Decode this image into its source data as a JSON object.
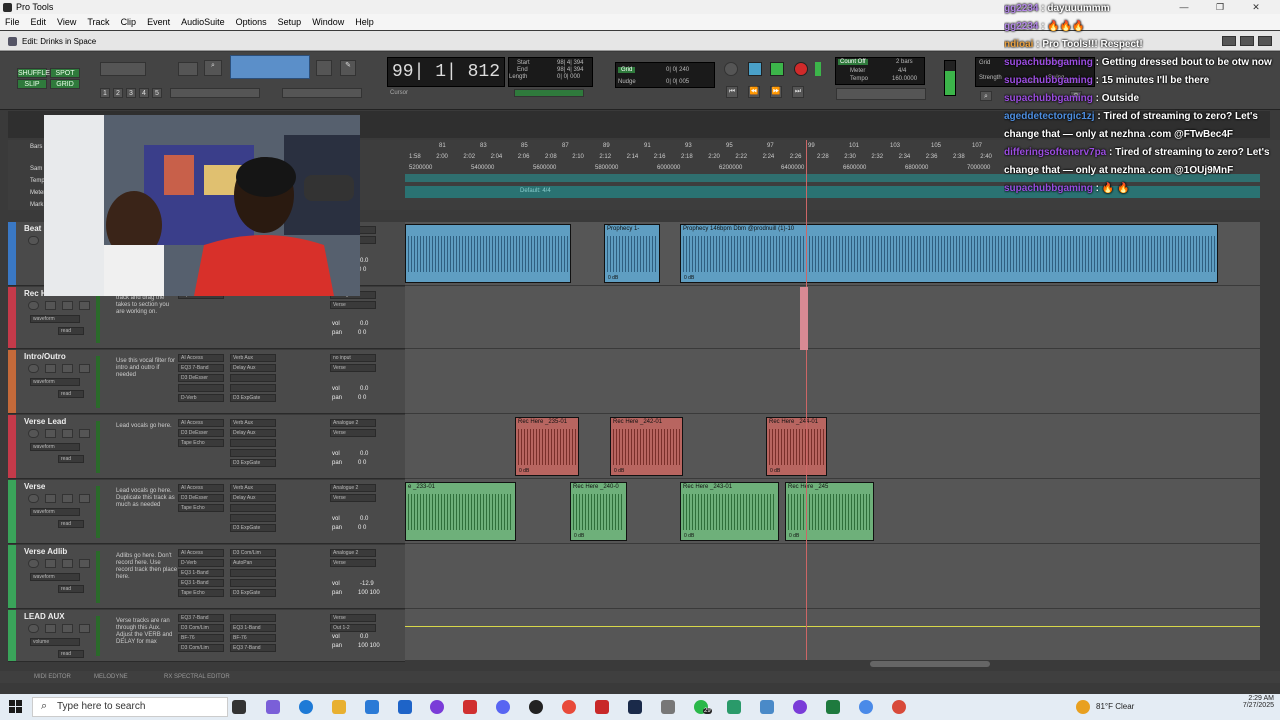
{
  "window": {
    "title": "Pro Tools",
    "controls": [
      "—",
      "❐",
      "✕"
    ]
  },
  "menu": [
    "File",
    "Edit",
    "View",
    "Track",
    "Clip",
    "Event",
    "AudioSuite",
    "Options",
    "Setup",
    "Window",
    "Help"
  ],
  "edit_window": {
    "title": "Edit: Drinks in Space"
  },
  "toolbar": {
    "modes": [
      "SHUFFLE",
      "SPOT",
      "SLIP",
      "GRID"
    ],
    "zoom_presets": [
      "1",
      "2",
      "3",
      "4",
      "5"
    ],
    "main_counter": "99| 1| 812",
    "counter_label": "Cursor",
    "start_label": "Start",
    "start_value": "98| 4| 394",
    "end_label": "End",
    "end_value": "98| 4| 394",
    "length_label": "Length",
    "length_value": "0| 0| 000",
    "grid_label": "Grid",
    "grid_value": "0| 0| 240",
    "nudge_label": "Nudge",
    "nudge_value": "0| 0| 005",
    "count_off": "Count Off",
    "count_bars": "2 bars",
    "meter_label": "Meter",
    "meter_value": "4/4",
    "tempo_label": "Tempo",
    "tempo_value": "160.0000",
    "grid2_label": "Grid",
    "grid2_value": "1/16 note",
    "strength_label": "Strength",
    "strength_value": "100%",
    "swing_label": "Swing",
    "swing_value": "100%"
  },
  "ruler": {
    "bars_label": "Bars",
    "bars": [
      "81",
      "83",
      "85",
      "87",
      "89",
      "91",
      "93",
      "95",
      "97",
      "99",
      "101",
      "103",
      "105",
      "107"
    ],
    "times": [
      "1:58",
      "2:00",
      "2:02",
      "2:04",
      "2:06",
      "2:08",
      "2:10",
      "2:12",
      "2:14",
      "2:16",
      "2:18",
      "2:20",
      "2:22",
      "2:24",
      "2:26",
      "2:28",
      "2:30",
      "2:32",
      "2:34",
      "2:36",
      "2:38",
      "2:40"
    ],
    "samples": [
      "5200000",
      "5400000",
      "5600000",
      "5800000",
      "6000000",
      "6200000",
      "6400000",
      "6600000",
      "6800000",
      "7000000"
    ],
    "meter_marker": "Default: 4/4",
    "side_labels": [
      "Sam",
      "Temp",
      "Meter",
      "Mark"
    ]
  },
  "tracks": [
    {
      "name": "Beat",
      "comment": "",
      "color": "#3a78c4",
      "inserts": [],
      "sends": [],
      "io": [
        "",
        ""
      ],
      "vol": "0.0",
      "pan": "0 0",
      "clips": [
        {
          "name": "",
          "start": 0,
          "end": 166,
          "color": "blue",
          "db": ""
        },
        {
          "name": "Prophecy 1-",
          "start": 199,
          "end": 255,
          "color": "blue",
          "db": "0 dB"
        },
        {
          "name": "Prophecy 146bpm Dbm @prodnuill (1)-10",
          "start": 275,
          "end": 813,
          "color": "blue",
          "db": "0 dB"
        }
      ]
    },
    {
      "name": "Rec Here",
      "comment": "track and drag the takes to section you are working on.",
      "color": "#c43a4a",
      "inserts": [
        "Tape Echo"
      ],
      "sends": [],
      "io": [
        "Analogue 2",
        "Verse"
      ],
      "vol": "0.0",
      "pan": "0 0",
      "mode": "waveform",
      "auto": "read",
      "clips": []
    },
    {
      "name": "Intro/Outro",
      "comment": "Use this vocal filter for intro and outro if needed",
      "color": "#c46a3a",
      "inserts": [
        "AI Access",
        "EQ3 7-Band",
        "D3 DeEsser",
        "",
        "D-Verb"
      ],
      "sends": [
        "Verb Aux",
        "Delay Aux",
        "",
        "",
        "D3 ExpGate"
      ],
      "io": [
        "no input",
        "Verse"
      ],
      "vol": "0.0",
      "pan": "0 0",
      "mode": "waveform",
      "auto": "read",
      "clips": []
    },
    {
      "name": "Verse Lead",
      "comment": "Lead vocals go here.",
      "color": "#c43a4a",
      "inserts": [
        "AI Access",
        "D3 DeEsser",
        "Tape Echo"
      ],
      "sends": [
        "Verb Aux",
        "Delay Aux",
        "",
        "",
        "D3 ExpGate"
      ],
      "io": [
        "Analogue 2",
        "Verse"
      ],
      "vol": "0.0",
      "pan": "0 0",
      "mode": "waveform",
      "auto": "read",
      "clips": [
        {
          "name": "Rec Here _235-01",
          "start": 110,
          "end": 174,
          "color": "red",
          "db": "0 dB"
        },
        {
          "name": "Rec Here _242-01",
          "start": 205,
          "end": 278,
          "color": "red",
          "db": "0 dB"
        },
        {
          "name": "Rec Here _244-01",
          "start": 361,
          "end": 422,
          "color": "red",
          "db": "0 dB"
        }
      ]
    },
    {
      "name": "Verse",
      "comment": "Lead vocals go here. Duplicate this track as much as needed",
      "color": "#3aa45a",
      "inserts": [
        "AI Access",
        "D3 DeEsser",
        "Tape Echo"
      ],
      "sends": [
        "Verb Aux",
        "Delay Aux",
        "",
        "",
        "D3 ExpGate"
      ],
      "io": [
        "Analogue 2",
        "Verse"
      ],
      "vol": "0.0",
      "pan": "0 0",
      "mode": "waveform",
      "auto": "read",
      "clips": [
        {
          "name": "e _233-01",
          "start": 0,
          "end": 111,
          "color": "green",
          "db": ""
        },
        {
          "name": "Rec Here _240-0",
          "start": 165,
          "end": 222,
          "color": "green",
          "db": "0 dB"
        },
        {
          "name": "Rec Here _243-01",
          "start": 275,
          "end": 374,
          "color": "green",
          "db": "0 dB"
        },
        {
          "name": "Rec Here _245",
          "start": 380,
          "end": 469,
          "color": "green",
          "db": "0 dB"
        }
      ]
    },
    {
      "name": "Verse Adlib",
      "comment": "Adlibs go here. Don't record here. Use record track then place here.",
      "color": "#3aa45a",
      "inserts": [
        "AI Access",
        "D-Verb",
        "EQ3 1-Band",
        "EQ3 1-Band",
        "Tape Echo"
      ],
      "sends": [
        "D3 Com/Lim",
        "AutoPan",
        "",
        "",
        "D3 ExpGate"
      ],
      "io": [
        "Analogue 2",
        "Verse"
      ],
      "vol": "-12.9",
      "pan": "100 100",
      "mode": "waveform",
      "auto": "read",
      "clips": []
    },
    {
      "name": "LEAD AUX",
      "comment": "Verse tracks are ran through this Aux. Adjust the VERB and DELAY for max",
      "color": "#3aa45a",
      "inserts": [
        "EQ3 7-Band",
        "D3 Com/Lim",
        "BF-76",
        "D3 Com/Lim"
      ],
      "sends": [
        "",
        "EQ3 1-Band",
        "BF-76",
        "EQ3 7-Band"
      ],
      "io": [
        "Verse",
        "Out 1-2"
      ],
      "vol": "0.0",
      "pan": "100 100",
      "mode": "volume",
      "auto": "read",
      "clips": []
    }
  ],
  "bottom_tabs": [
    "MIDI EDITOR",
    "MELODYNE",
    "RX SPECTRAL EDITOR"
  ],
  "chat": [
    {
      "user": "gg2234",
      "msg": "dayuuummm",
      "color": "#b488e8"
    },
    {
      "user": "gg2234",
      "msg": "🔥🔥🔥",
      "color": "#b488e8"
    },
    {
      "user": "ndioai",
      "msg": "Pro Tools!!! Respect!",
      "color": "#e8a040"
    },
    {
      "user": "supachubbgaming",
      "msg": "Getting dressed bout to be otw now",
      "color": "#9b4de0"
    },
    {
      "user": "supachubbgaming",
      "msg": "15 minutes I'll be there",
      "color": "#9b4de0"
    },
    {
      "user": "supachubbgaming",
      "msg": "Outside",
      "color": "#9b4de0"
    },
    {
      "user": "ageddetectorgic1zj",
      "msg": "Tired of streaming to zero? Let's change that — only at nezhna .com @FTwBec4F",
      "color": "#4d8ee0"
    },
    {
      "user": "differingsoftenerv7pa",
      "msg": "Tired of streaming to zero? Let's change that — only at nezhna .com @1OUj9MnF",
      "color": "#9b4de0"
    },
    {
      "user": "supachubbgaming",
      "msg": "🔥 🔥",
      "color": "#9b4de0"
    }
  ],
  "taskbar": {
    "search_placeholder": "Type here to search",
    "weather": "81°F  Clear",
    "time": "2:29 AM",
    "date": "7/27/2025",
    "badge": "29"
  }
}
